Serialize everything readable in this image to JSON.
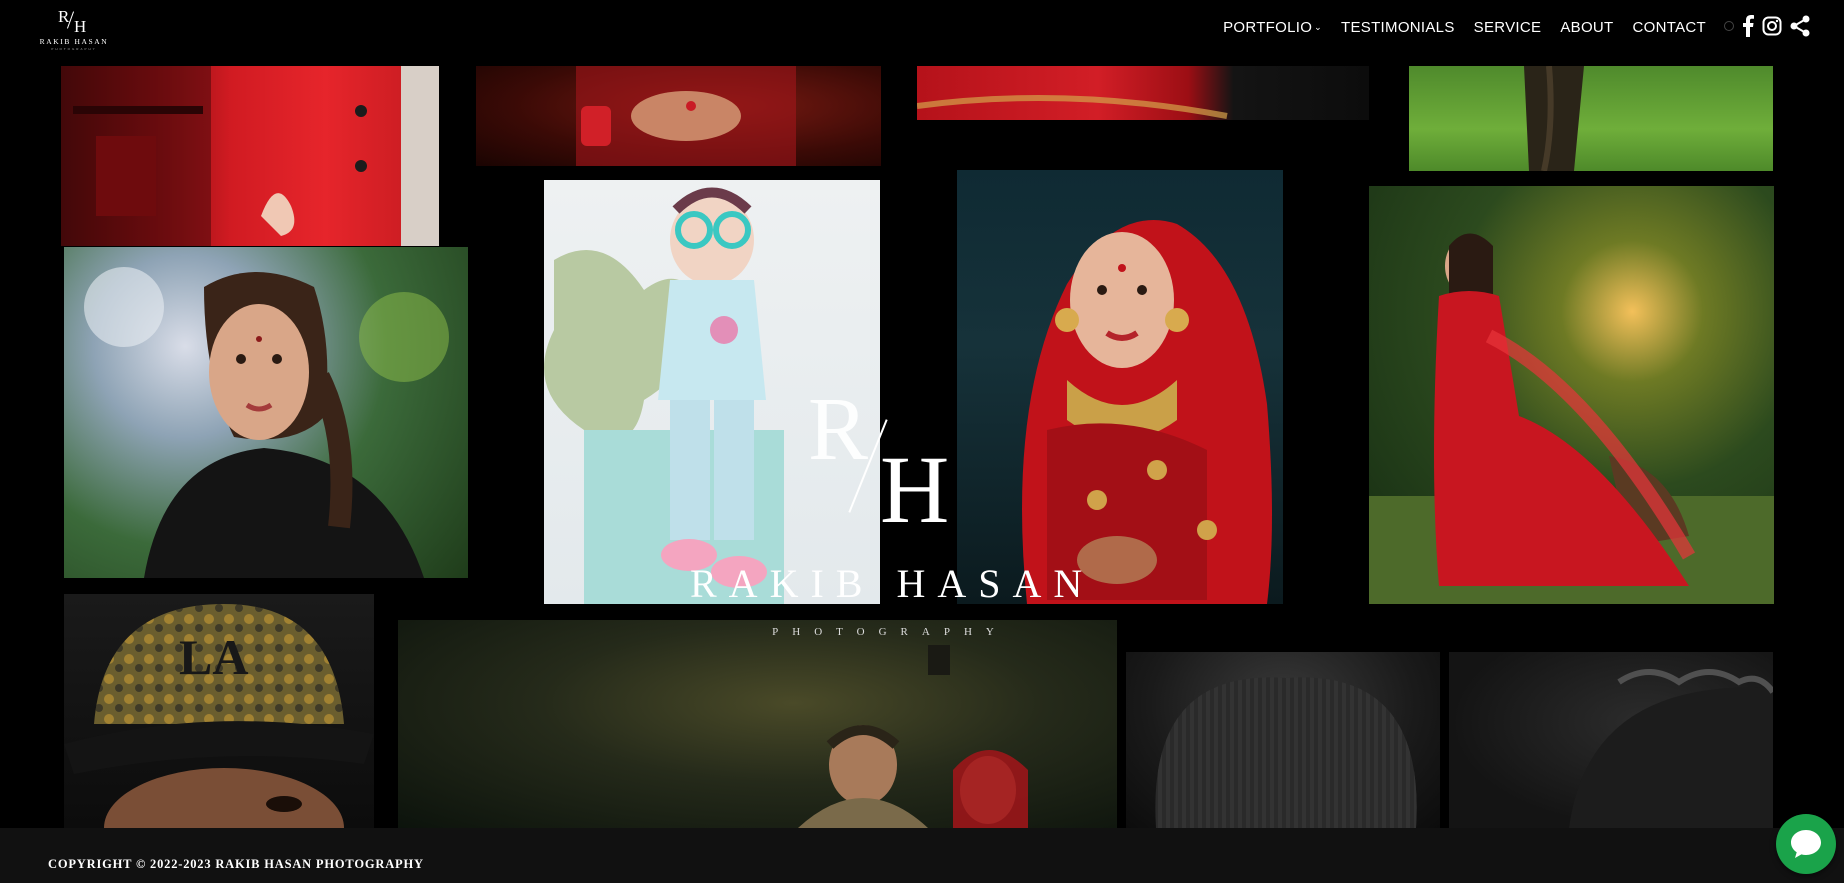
{
  "brand": {
    "mono_r": "R",
    "mono_h": "H",
    "name": "RAKIB HASAN",
    "sub": "PHOTOGRAPHY"
  },
  "nav": {
    "items": [
      {
        "label": "PORTFOLIO",
        "has_dropdown": true
      },
      {
        "label": "TESTIMONIALS"
      },
      {
        "label": "SERVICE"
      },
      {
        "label": "ABOUT"
      },
      {
        "label": "CONTACT"
      }
    ]
  },
  "socials": [
    "facebook-icon",
    "instagram-icon",
    "share-icon"
  ],
  "watermark": {
    "r": "R",
    "h": "H",
    "name": "RAKIB HASAN",
    "sub": "PHOTOGRAPHY"
  },
  "footer": {
    "copyright": "COPYRIGHT © 2022-2023 RAKIB HASAN PHOTOGRAPHY"
  },
  "colors": {
    "background": "#000000",
    "footer": "#111111",
    "chat": "#1aa34a",
    "accent_red": "#c8141e"
  },
  "chat_icon": "chat-bubble-icon"
}
